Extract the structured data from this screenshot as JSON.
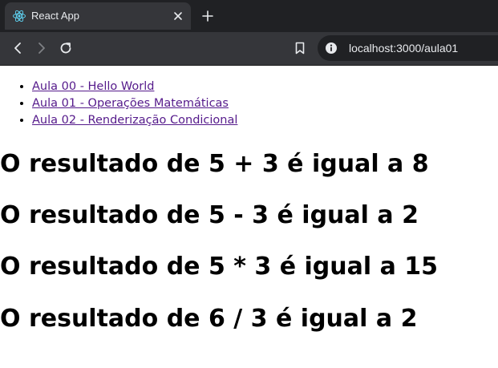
{
  "browser": {
    "tab": {
      "title": "React App",
      "favicon": "react-logo-icon"
    },
    "toolbar": {
      "url": "localhost:3000/aula01"
    },
    "colors": {
      "tabstrip_bg": "#202124",
      "toolbar_bg": "#35363a",
      "omnibox_bg": "#202124",
      "chrome_text": "#e8eaed",
      "react_cyan": "#61dafb"
    }
  },
  "page": {
    "nav": [
      {
        "label": "Aula 00 - Hello World"
      },
      {
        "label": "Aula 01 - Operações Matemáticas"
      },
      {
        "label": "Aula 02 - Renderização Condicional"
      }
    ],
    "results": [
      "O resultado de 5 + 3 é igual a 8",
      "O resultado de 5 - 3 é igual a 2",
      "O resultado de 5 * 3 é igual a 15",
      "O resultado de 6 / 3 é igual a 2"
    ],
    "colors": {
      "link_visited": "#551a8b",
      "text": "#000000",
      "background": "#ffffff"
    }
  }
}
